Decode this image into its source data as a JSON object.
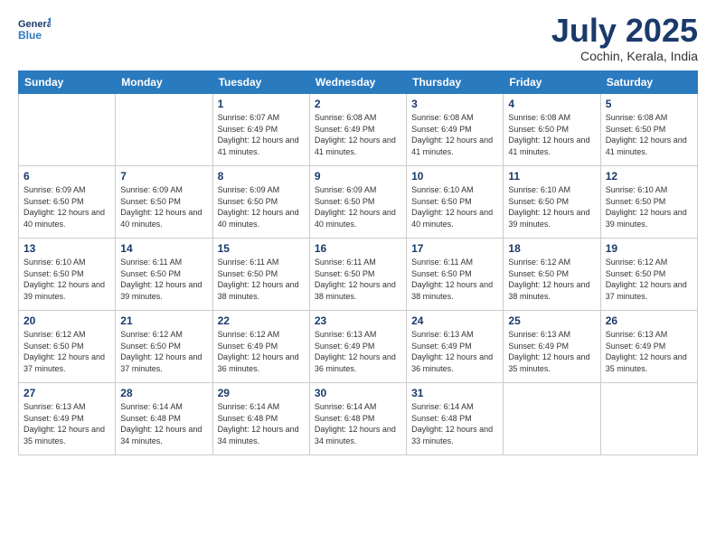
{
  "header": {
    "logo_line1": "General",
    "logo_line2": "Blue",
    "title": "July 2025",
    "location": "Cochin, Kerala, India"
  },
  "weekdays": [
    "Sunday",
    "Monday",
    "Tuesday",
    "Wednesday",
    "Thursday",
    "Friday",
    "Saturday"
  ],
  "weeks": [
    [
      {
        "day": "",
        "info": ""
      },
      {
        "day": "",
        "info": ""
      },
      {
        "day": "1",
        "info": "Sunrise: 6:07 AM\nSunset: 6:49 PM\nDaylight: 12 hours and 41 minutes."
      },
      {
        "day": "2",
        "info": "Sunrise: 6:08 AM\nSunset: 6:49 PM\nDaylight: 12 hours and 41 minutes."
      },
      {
        "day": "3",
        "info": "Sunrise: 6:08 AM\nSunset: 6:49 PM\nDaylight: 12 hours and 41 minutes."
      },
      {
        "day": "4",
        "info": "Sunrise: 6:08 AM\nSunset: 6:50 PM\nDaylight: 12 hours and 41 minutes."
      },
      {
        "day": "5",
        "info": "Sunrise: 6:08 AM\nSunset: 6:50 PM\nDaylight: 12 hours and 41 minutes."
      }
    ],
    [
      {
        "day": "6",
        "info": "Sunrise: 6:09 AM\nSunset: 6:50 PM\nDaylight: 12 hours and 40 minutes."
      },
      {
        "day": "7",
        "info": "Sunrise: 6:09 AM\nSunset: 6:50 PM\nDaylight: 12 hours and 40 minutes."
      },
      {
        "day": "8",
        "info": "Sunrise: 6:09 AM\nSunset: 6:50 PM\nDaylight: 12 hours and 40 minutes."
      },
      {
        "day": "9",
        "info": "Sunrise: 6:09 AM\nSunset: 6:50 PM\nDaylight: 12 hours and 40 minutes."
      },
      {
        "day": "10",
        "info": "Sunrise: 6:10 AM\nSunset: 6:50 PM\nDaylight: 12 hours and 40 minutes."
      },
      {
        "day": "11",
        "info": "Sunrise: 6:10 AM\nSunset: 6:50 PM\nDaylight: 12 hours and 39 minutes."
      },
      {
        "day": "12",
        "info": "Sunrise: 6:10 AM\nSunset: 6:50 PM\nDaylight: 12 hours and 39 minutes."
      }
    ],
    [
      {
        "day": "13",
        "info": "Sunrise: 6:10 AM\nSunset: 6:50 PM\nDaylight: 12 hours and 39 minutes."
      },
      {
        "day": "14",
        "info": "Sunrise: 6:11 AM\nSunset: 6:50 PM\nDaylight: 12 hours and 39 minutes."
      },
      {
        "day": "15",
        "info": "Sunrise: 6:11 AM\nSunset: 6:50 PM\nDaylight: 12 hours and 38 minutes."
      },
      {
        "day": "16",
        "info": "Sunrise: 6:11 AM\nSunset: 6:50 PM\nDaylight: 12 hours and 38 minutes."
      },
      {
        "day": "17",
        "info": "Sunrise: 6:11 AM\nSunset: 6:50 PM\nDaylight: 12 hours and 38 minutes."
      },
      {
        "day": "18",
        "info": "Sunrise: 6:12 AM\nSunset: 6:50 PM\nDaylight: 12 hours and 38 minutes."
      },
      {
        "day": "19",
        "info": "Sunrise: 6:12 AM\nSunset: 6:50 PM\nDaylight: 12 hours and 37 minutes."
      }
    ],
    [
      {
        "day": "20",
        "info": "Sunrise: 6:12 AM\nSunset: 6:50 PM\nDaylight: 12 hours and 37 minutes."
      },
      {
        "day": "21",
        "info": "Sunrise: 6:12 AM\nSunset: 6:50 PM\nDaylight: 12 hours and 37 minutes."
      },
      {
        "day": "22",
        "info": "Sunrise: 6:12 AM\nSunset: 6:49 PM\nDaylight: 12 hours and 36 minutes."
      },
      {
        "day": "23",
        "info": "Sunrise: 6:13 AM\nSunset: 6:49 PM\nDaylight: 12 hours and 36 minutes."
      },
      {
        "day": "24",
        "info": "Sunrise: 6:13 AM\nSunset: 6:49 PM\nDaylight: 12 hours and 36 minutes."
      },
      {
        "day": "25",
        "info": "Sunrise: 6:13 AM\nSunset: 6:49 PM\nDaylight: 12 hours and 35 minutes."
      },
      {
        "day": "26",
        "info": "Sunrise: 6:13 AM\nSunset: 6:49 PM\nDaylight: 12 hours and 35 minutes."
      }
    ],
    [
      {
        "day": "27",
        "info": "Sunrise: 6:13 AM\nSunset: 6:49 PM\nDaylight: 12 hours and 35 minutes."
      },
      {
        "day": "28",
        "info": "Sunrise: 6:14 AM\nSunset: 6:48 PM\nDaylight: 12 hours and 34 minutes."
      },
      {
        "day": "29",
        "info": "Sunrise: 6:14 AM\nSunset: 6:48 PM\nDaylight: 12 hours and 34 minutes."
      },
      {
        "day": "30",
        "info": "Sunrise: 6:14 AM\nSunset: 6:48 PM\nDaylight: 12 hours and 34 minutes."
      },
      {
        "day": "31",
        "info": "Sunrise: 6:14 AM\nSunset: 6:48 PM\nDaylight: 12 hours and 33 minutes."
      },
      {
        "day": "",
        "info": ""
      },
      {
        "day": "",
        "info": ""
      }
    ]
  ]
}
